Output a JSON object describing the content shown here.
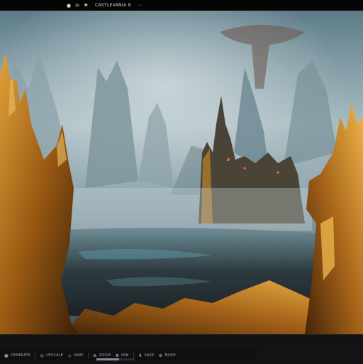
{
  "app": {
    "title": "CASTLEVANIA 8"
  },
  "topbar": {
    "icons": [
      "circle-icon",
      "rotate-icon",
      "flag-icon",
      "more-icon"
    ],
    "icon_glyphs": [
      "●",
      "⟳",
      "⚑",
      "⋯"
    ]
  },
  "bottombar": {
    "items": [
      {
        "icon": "image-icon",
        "glyph": "▣",
        "label": "GENERATE"
      },
      {
        "icon": "upscale-icon",
        "glyph": "◎",
        "label": "UPSCALE"
      },
      {
        "icon": "vary-icon",
        "glyph": "◇",
        "label": "VARY"
      },
      {
        "icon": "zoom-icon",
        "glyph": "⊕",
        "label": "ZOOM"
      },
      {
        "icon": "pan-icon",
        "glyph": "✥",
        "label": "PAN"
      },
      {
        "icon": "download-icon",
        "glyph": "⬇",
        "label": "SAVE"
      },
      {
        "icon": "settings-icon",
        "glyph": "⚙",
        "label": "MORE"
      }
    ],
    "progress": 0.6
  },
  "colors": {
    "bar": "#0c0c0e",
    "sky": "#8fa6b0",
    "castle": "#b8741a",
    "rock": "#c88b2a"
  }
}
